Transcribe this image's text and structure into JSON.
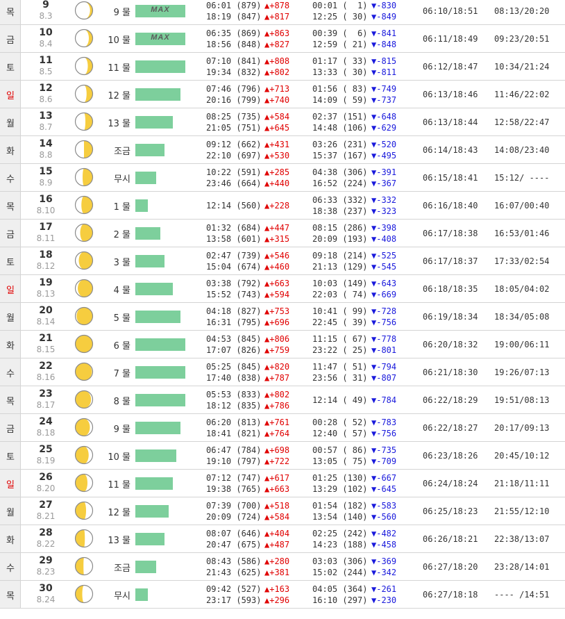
{
  "rows": [
    {
      "dow": "목",
      "day": "9",
      "lunar": "8.3",
      "phase": "9 물",
      "level": 1.0,
      "max": "MAX",
      "high": [
        "06:01 (879)",
        "18:19 (847)"
      ],
      "hch": [
        "▲+878",
        "▲+817"
      ],
      "low": [
        "00:01 (  1)",
        "12:25 ( 30)"
      ],
      "lch": [
        "▼-830",
        "▼-849"
      ],
      "sun": "06:10/18:51",
      "moonrs": "08:13/20:20",
      "illum": 0.15,
      "lit": "right",
      "sunday": false
    },
    {
      "dow": "금",
      "day": "10",
      "lunar": "8.4",
      "phase": "10 물",
      "level": 1.0,
      "max": "MAX",
      "high": [
        "06:35 (869)",
        "18:56 (848)"
      ],
      "hch": [
        "▲+863",
        "▲+827"
      ],
      "low": [
        "00:39 (  6)",
        "12:59 ( 21)"
      ],
      "lch": [
        "▼-841",
        "▼-848"
      ],
      "sun": "06:11/18:49",
      "moonrs": "09:23/20:51",
      "illum": 0.22,
      "lit": "right",
      "sunday": false
    },
    {
      "dow": "토",
      "day": "11",
      "lunar": "8.5",
      "phase": "11 물",
      "level": 1.0,
      "max": "",
      "high": [
        "07:10 (841)",
        "19:34 (832)"
      ],
      "hch": [
        "▲+808",
        "▲+802"
      ],
      "low": [
        "01:17 ( 33)",
        "13:33 ( 30)"
      ],
      "lch": [
        "▼-815",
        "▼-811"
      ],
      "sun": "06:12/18:47",
      "moonrs": "10:34/21:24",
      "illum": 0.28,
      "lit": "right",
      "sunday": false
    },
    {
      "dow": "일",
      "day": "12",
      "lunar": "8.6",
      "phase": "12 물",
      "level": 0.9,
      "max": "",
      "high": [
        "07:46 (796)",
        "20:16 (799)"
      ],
      "hch": [
        "▲+713",
        "▲+740"
      ],
      "low": [
        "01:56 ( 83)",
        "14:09 ( 59)"
      ],
      "lch": [
        "▼-749",
        "▼-737"
      ],
      "sun": "06:13/18:46",
      "moonrs": "11:46/22:02",
      "illum": 0.35,
      "lit": "right",
      "sunday": true
    },
    {
      "dow": "월",
      "day": "13",
      "lunar": "8.7",
      "phase": "13 물",
      "level": 0.75,
      "max": "",
      "high": [
        "08:25 (735)",
        "21:05 (751)"
      ],
      "hch": [
        "▲+584",
        "▲+645"
      ],
      "low": [
        "02:37 (151)",
        "14:48 (106)"
      ],
      "lch": [
        "▼-648",
        "▼-629"
      ],
      "sun": "06:13/18:44",
      "moonrs": "12:58/22:47",
      "illum": 0.42,
      "lit": "right",
      "sunday": false
    },
    {
      "dow": "화",
      "day": "14",
      "lunar": "8.8",
      "phase": "조금",
      "level": 0.58,
      "max": "",
      "high": [
        "09:12 (662)",
        "22:10 (697)"
      ],
      "hch": [
        "▲+431",
        "▲+530"
      ],
      "low": [
        "03:26 (231)",
        "15:37 (167)"
      ],
      "lch": [
        "▼-520",
        "▼-495"
      ],
      "sun": "06:14/18:43",
      "moonrs": "14:08/23:40",
      "illum": 0.5,
      "lit": "right",
      "sunday": false
    },
    {
      "dow": "수",
      "day": "15",
      "lunar": "8.9",
      "phase": "무시",
      "level": 0.42,
      "max": "",
      "high": [
        "10:22 (591)",
        "23:46 (664)"
      ],
      "hch": [
        "▲+285",
        "▲+440"
      ],
      "low": [
        "04:38 (306)",
        "16:52 (224)"
      ],
      "lch": [
        "▼-391",
        "▼-367"
      ],
      "sun": "06:15/18:41",
      "moonrs": "15:12/ ----",
      "illum": 0.58,
      "lit": "right",
      "sunday": false
    },
    {
      "dow": "목",
      "day": "16",
      "lunar": "8.10",
      "phase": "1 물",
      "level": 0.25,
      "max": "",
      "high": [
        "12:14 (560)"
      ],
      "hch": [
        "▲+228"
      ],
      "low": [
        "06:33 (332)",
        "18:38 (237)"
      ],
      "lch": [
        "▼-332",
        "▼-323"
      ],
      "sun": "06:16/18:40",
      "moonrs": "16:07/00:40",
      "illum": 0.65,
      "lit": "right",
      "sunday": false
    },
    {
      "dow": "금",
      "day": "17",
      "lunar": "8.11",
      "phase": "2 물",
      "level": 0.5,
      "max": "",
      "high": [
        "01:32 (684)",
        "13:58 (601)"
      ],
      "hch": [
        "▲+447",
        "▲+315"
      ],
      "low": [
        "08:15 (286)",
        "20:09 (193)"
      ],
      "lch": [
        "▼-398",
        "▼-408"
      ],
      "sun": "06:17/18:38",
      "moonrs": "16:53/01:46",
      "illum": 0.72,
      "lit": "right",
      "sunday": false
    },
    {
      "dow": "토",
      "day": "18",
      "lunar": "8.12",
      "phase": "3 물",
      "level": 0.58,
      "max": "",
      "high": [
        "02:47 (739)",
        "15:04 (674)"
      ],
      "hch": [
        "▲+546",
        "▲+460"
      ],
      "low": [
        "09:18 (214)",
        "21:13 (129)"
      ],
      "lch": [
        "▼-525",
        "▼-545"
      ],
      "sun": "06:17/18:37",
      "moonrs": "17:33/02:54",
      "illum": 0.8,
      "lit": "right",
      "sunday": false
    },
    {
      "dow": "일",
      "day": "19",
      "lunar": "8.13",
      "phase": "4 물",
      "level": 0.75,
      "max": "",
      "high": [
        "03:38 (792)",
        "15:52 (743)"
      ],
      "hch": [
        "▲+663",
        "▲+594"
      ],
      "low": [
        "10:03 (149)",
        "22:03 ( 74)"
      ],
      "lch": [
        "▼-643",
        "▼-669"
      ],
      "sun": "06:18/18:35",
      "moonrs": "18:05/04:02",
      "illum": 0.86,
      "lit": "right",
      "sunday": true
    },
    {
      "dow": "월",
      "day": "20",
      "lunar": "8.14",
      "phase": "5 물",
      "level": 0.9,
      "max": "",
      "high": [
        "04:18 (827)",
        "16:31 (795)"
      ],
      "hch": [
        "▲+753",
        "▲+696"
      ],
      "low": [
        "10:41 ( 99)",
        "22:45 ( 39)"
      ],
      "lch": [
        "▼-728",
        "▼-756"
      ],
      "sun": "06:19/18:34",
      "moonrs": "18:34/05:08",
      "illum": 0.93,
      "lit": "right",
      "sunday": false
    },
    {
      "dow": "화",
      "day": "21",
      "lunar": "8.15",
      "phase": "6 물",
      "level": 1.0,
      "max": "",
      "high": [
        "04:53 (845)",
        "17:07 (826)"
      ],
      "hch": [
        "▲+806",
        "▲+759"
      ],
      "low": [
        "11:15 ( 67)",
        "23:22 ( 25)"
      ],
      "lch": [
        "▼-778",
        "▼-801"
      ],
      "sun": "06:20/18:32",
      "moonrs": "19:00/06:11",
      "illum": 1.0,
      "lit": "right",
      "sunday": false
    },
    {
      "dow": "수",
      "day": "22",
      "lunar": "8.16",
      "phase": "7 물",
      "level": 1.0,
      "max": "",
      "high": [
        "05:25 (845)",
        "17:40 (838)"
      ],
      "hch": [
        "▲+820",
        "▲+787"
      ],
      "low": [
        "11:47 ( 51)",
        "23:56 ( 31)"
      ],
      "lch": [
        "▼-794",
        "▼-807"
      ],
      "sun": "06:21/18:30",
      "moonrs": "19:26/07:13",
      "illum": 0.96,
      "lit": "left",
      "sunday": false
    },
    {
      "dow": "목",
      "day": "23",
      "lunar": "8.17",
      "phase": "8 물",
      "level": 1.0,
      "max": "",
      "high": [
        "05:53 (833)",
        "18:12 (835)"
      ],
      "hch": [
        "▲+802",
        "▲+786"
      ],
      "low": [
        "12:14 ( 49)"
      ],
      "lch": [
        "▼-784"
      ],
      "sun": "06:22/18:29",
      "moonrs": "19:51/08:13",
      "illum": 0.91,
      "lit": "left",
      "sunday": false
    },
    {
      "dow": "금",
      "day": "24",
      "lunar": "8.18",
      "phase": "9 물",
      "level": 0.9,
      "max": "",
      "high": [
        "06:20 (813)",
        "18:41 (821)"
      ],
      "hch": [
        "▲+761",
        "▲+764"
      ],
      "low": [
        "00:28 ( 52)",
        "12:40 ( 57)"
      ],
      "lch": [
        "▼-783",
        "▼-756"
      ],
      "sun": "06:22/18:27",
      "moonrs": "20:17/09:13",
      "illum": 0.84,
      "lit": "left",
      "sunday": false
    },
    {
      "dow": "토",
      "day": "25",
      "lunar": "8.19",
      "phase": "10 물",
      "level": 0.82,
      "max": "",
      "high": [
        "06:47 (784)",
        "19:10 (797)"
      ],
      "hch": [
        "▲+698",
        "▲+722"
      ],
      "low": [
        "00:57 ( 86)",
        "13:05 ( 75)"
      ],
      "lch": [
        "▼-735",
        "▼-709"
      ],
      "sun": "06:23/18:26",
      "moonrs": "20:45/10:12",
      "illum": 0.77,
      "lit": "left",
      "sunday": false
    },
    {
      "dow": "일",
      "day": "26",
      "lunar": "8.20",
      "phase": "11 물",
      "level": 0.75,
      "max": "",
      "high": [
        "07:12 (747)",
        "19:38 (765)"
      ],
      "hch": [
        "▲+617",
        "▲+663"
      ],
      "low": [
        "01:25 (130)",
        "13:29 (102)"
      ],
      "lch": [
        "▼-667",
        "▼-645"
      ],
      "sun": "06:24/18:24",
      "moonrs": "21:18/11:11",
      "illum": 0.7,
      "lit": "left",
      "sunday": true
    },
    {
      "dow": "월",
      "day": "27",
      "lunar": "8.21",
      "phase": "12 물",
      "level": 0.67,
      "max": "",
      "high": [
        "07:39 (700)",
        "20:09 (724)"
      ],
      "hch": [
        "▲+518",
        "▲+584"
      ],
      "low": [
        "01:54 (182)",
        "13:54 (140)"
      ],
      "lch": [
        "▼-583",
        "▼-560"
      ],
      "sun": "06:25/18:23",
      "moonrs": "21:55/12:10",
      "illum": 0.62,
      "lit": "left",
      "sunday": false
    },
    {
      "dow": "화",
      "day": "28",
      "lunar": "8.22",
      "phase": "13 물",
      "level": 0.58,
      "max": "",
      "high": [
        "08:07 (646)",
        "20:47 (675)"
      ],
      "hch": [
        "▲+404",
        "▲+487"
      ],
      "low": [
        "02:25 (242)",
        "14:23 (188)"
      ],
      "lch": [
        "▼-482",
        "▼-458"
      ],
      "sun": "06:26/18:21",
      "moonrs": "22:38/13:07",
      "illum": 0.55,
      "lit": "left",
      "sunday": false
    },
    {
      "dow": "수",
      "day": "29",
      "lunar": "8.23",
      "phase": "조금",
      "level": 0.42,
      "max": "",
      "high": [
        "08:43 (586)",
        "21:43 (625)"
      ],
      "hch": [
        "▲+280",
        "▲+381"
      ],
      "low": [
        "03:03 (306)",
        "15:02 (244)"
      ],
      "lch": [
        "▼-369",
        "▼-342"
      ],
      "sun": "06:27/18:20",
      "moonrs": "23:28/14:01",
      "illum": 0.47,
      "lit": "left",
      "sunday": false
    },
    {
      "dow": "목",
      "day": "30",
      "lunar": "8.24",
      "phase": "무시",
      "level": 0.25,
      "max": "",
      "high": [
        "09:42 (527)",
        "23:17 (593)"
      ],
      "hch": [
        "▲+163",
        "▲+296"
      ],
      "low": [
        "04:05 (364)",
        "16:10 (297)"
      ],
      "lch": [
        "▼-261",
        "▼-230"
      ],
      "sun": "06:27/18:18",
      "moonrs": "---- /14:51",
      "illum": 0.4,
      "lit": "left",
      "sunday": false
    }
  ],
  "colors": {
    "bar": "#7dcf9c",
    "moon": "#f6cd3f",
    "moon_dark": "#ffffff",
    "rise": "#e00000",
    "fall": "#1a1adc",
    "sunday": "#e00000"
  }
}
